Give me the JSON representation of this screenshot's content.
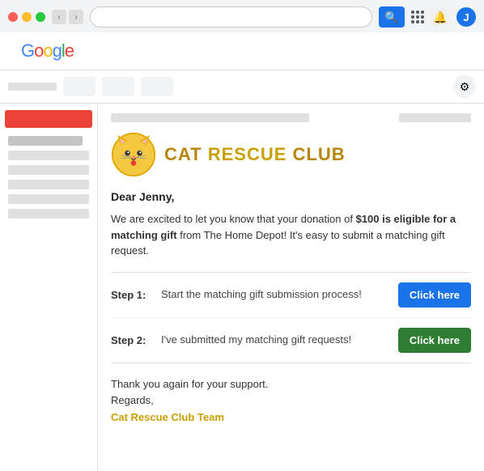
{
  "browser": {
    "address": "",
    "refresh_char": "↻"
  },
  "google": {
    "logo": {
      "G": "G",
      "o1": "o",
      "o2": "o",
      "g": "g",
      "l": "l",
      "e": "e"
    },
    "avatar_letter": "J",
    "bell_char": "🔔"
  },
  "gmail": {
    "toolbar_buttons": [
      "",
      "",
      ""
    ],
    "settings_char": "⚙",
    "compose_label": ""
  },
  "email": {
    "subject": "",
    "org": {
      "name_cat": "CAT",
      "name_rescue": "RESCUE",
      "name_club": "CLUB"
    },
    "greeting": "Dear Jenny,",
    "body_part1": "We are excited to let you know that your donation of ",
    "body_bold": "$100 is eligible for a matching gift",
    "body_part2": " from The Home Depot! It's easy to submit a matching gift request.",
    "step1_label": "Step 1:",
    "step1_desc": "Start the matching gift submission process!",
    "step1_btn": "Click here",
    "step2_label": "Step 2:",
    "step2_desc": "I've submitted my matching gift requests!",
    "step2_btn": "Click here",
    "footer_line1": "Thank you again for your support.",
    "footer_line2": "Regards,",
    "footer_team": "Cat Rescue Club Team"
  }
}
